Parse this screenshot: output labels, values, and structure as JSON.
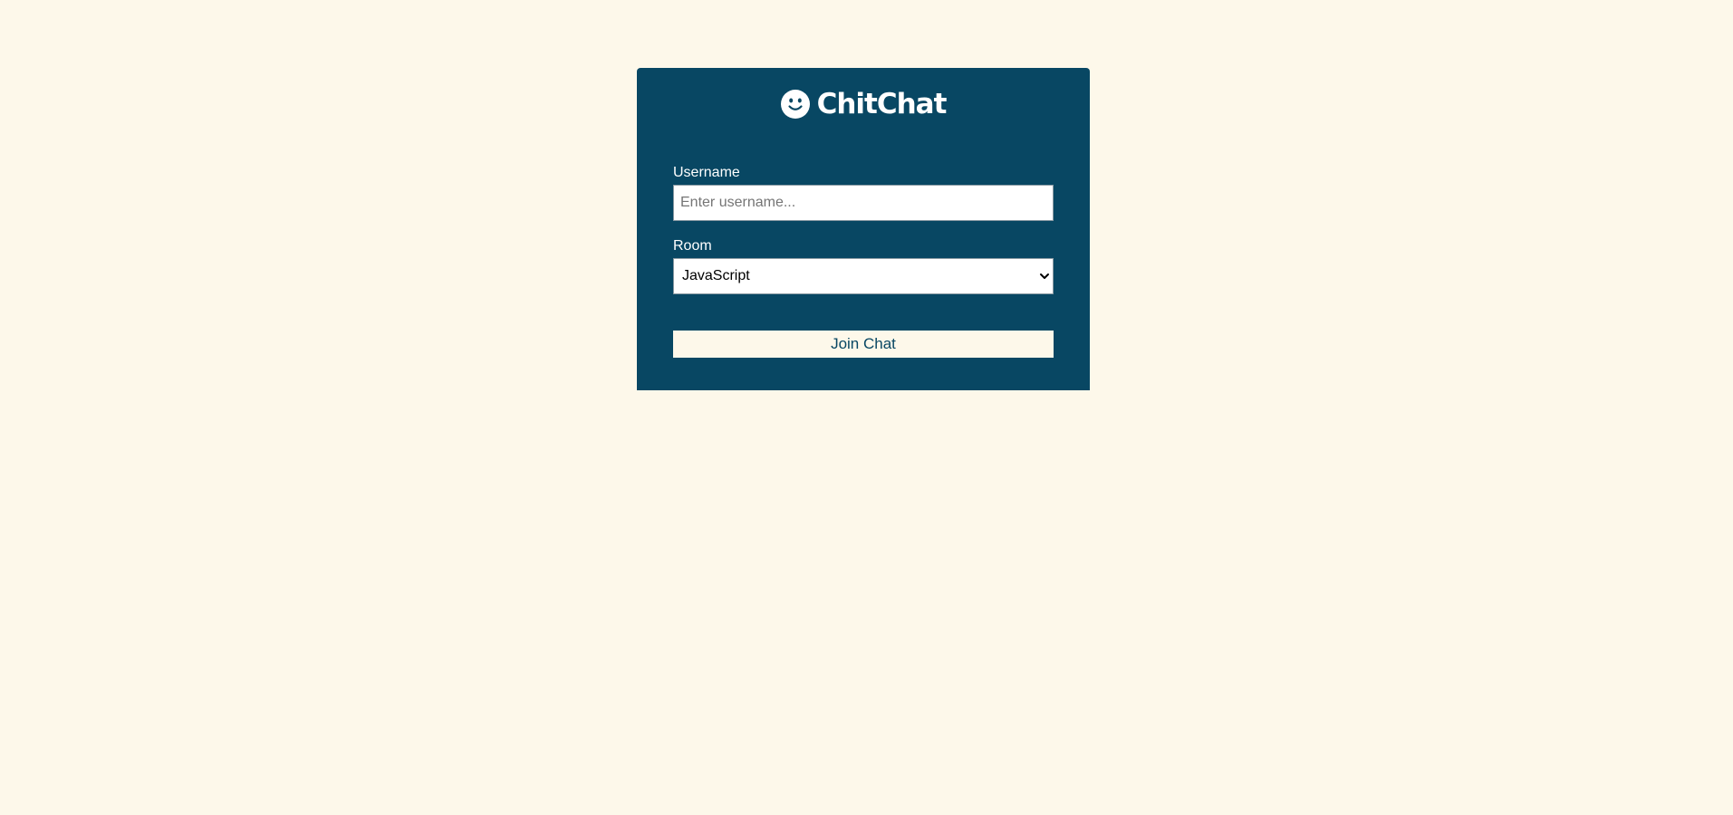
{
  "app": {
    "title": "ChitChat",
    "logo_icon": "smile-icon"
  },
  "form": {
    "username_label": "Username",
    "username_placeholder": "Enter username...",
    "username_value": "",
    "room_label": "Room",
    "room_selected": "JavaScript",
    "join_label": "Join Chat"
  },
  "colors": {
    "page_background": "#fdf8ea",
    "card_background": "#084763",
    "button_background": "#fdf8ea",
    "button_text": "#084763"
  }
}
